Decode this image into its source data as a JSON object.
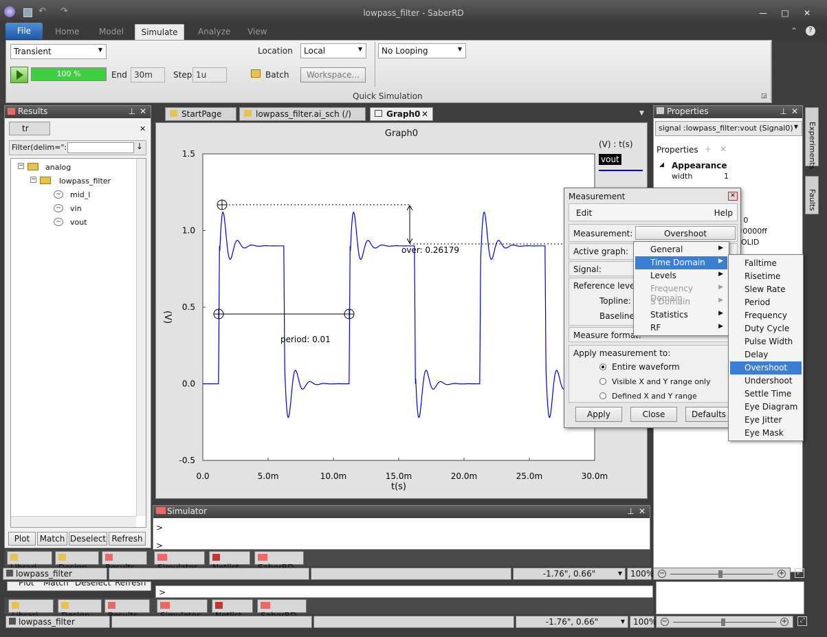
{
  "window": {
    "title": "lowpass_filter - SaberRD"
  },
  "ribbon": {
    "tabs": [
      "File",
      "Home",
      "Model",
      "Simulate",
      "Analyze",
      "View"
    ],
    "analysis_type": "Transient",
    "progress_text": "100 %",
    "progress": 1.0,
    "end_label": "End",
    "end_value": "30m",
    "step_label": "Step",
    "step_value": "1u",
    "location_label": "Location",
    "location_value": "Local",
    "batch_label": "Batch",
    "workspace_label": "Workspace...",
    "looping_value": "No Looping",
    "group_label": "Quick Simulation"
  },
  "results": {
    "title": "Results",
    "tab": "tr",
    "filter_label": "Filter(delim=\":\")",
    "tree": {
      "root": "analog",
      "child": "lowpass_filter",
      "signals": [
        "mid_l",
        "vin",
        "vout"
      ]
    },
    "buttons": [
      "Plot",
      "Match",
      "Deselect",
      "Refresh"
    ]
  },
  "doc_tabs": [
    "StartPage",
    "lowpass_filter.ai_sch (/)",
    "Graph0"
  ],
  "graph": {
    "title": "Graph0",
    "legend_units": "(V) : t(s)",
    "legend_signal": "vout",
    "ylabel": "(V)",
    "xlabel": "t(s)",
    "over_annotation": "over: 0.26179",
    "period_annotation": "period: 0.01",
    "y_ticks": [
      "1.5",
      "1.0",
      "0.5",
      "0.0",
      "-0.5"
    ],
    "x_ticks": [
      "0.0",
      "5.0m",
      "10.0m",
      "15.0m",
      "20.0m",
      "25.0m",
      "30.0m"
    ],
    "color_signal": "#0000cc"
  },
  "chart_data": {
    "type": "line",
    "title": "Graph0",
    "xlabel": "t(s)",
    "ylabel": "(V)",
    "xlim": [
      0,
      0.03
    ],
    "ylim": [
      -0.5,
      1.5
    ],
    "series": [
      {
        "name": "vout",
        "color": "#0000cc"
      }
    ],
    "square_wave": {
      "period": 0.01,
      "high": 0.9,
      "low": 0.0,
      "overshoot": 0.26179,
      "first_rise": 0.0012
    },
    "annotations": [
      "over: 0.26179",
      "period: 0.01"
    ]
  },
  "simulator": {
    "title": "Simulator",
    "prompt1": ">",
    "prompt2": ">"
  },
  "properties": {
    "title": "Properties",
    "signal_selector": "signal :lowpass_filter:vout (Signal0)",
    "sub_title": "Properties",
    "section": "Appearance",
    "width_label": "width",
    "width_value": "1",
    "partial1": "g 0",
    "partial2": "#0000ff",
    "partial3": "SOLID"
  },
  "side_tabs": [
    "Experiments",
    "Faults"
  ],
  "measurement": {
    "title": "Measurement",
    "menu_edit": "Edit",
    "menu_help": "Help",
    "measurement_label": "Measurement:",
    "measurement_value": "Overshoot",
    "active_graph_label": "Active graph:",
    "signal_label": "Signal:",
    "reference_label": "Reference levels:",
    "topline_label": "Topline:",
    "baseline_label": "Baseline:",
    "format_label": "Measure format:",
    "apply_to_label": "Apply measurement to:",
    "opt_entire": "Entire waveform",
    "opt_visible": "Visible X and Y range only",
    "opt_defined": "Defined X and Y range",
    "apply": "Apply",
    "close": "Close",
    "defaults": "Defaults"
  },
  "menu1": [
    "General",
    "Time Domain",
    "Levels",
    "Frequency Domain",
    "S Domain",
    "Statistics",
    "RF"
  ],
  "menu2": [
    "Falltime",
    "Risetime",
    "Slew Rate",
    "Period",
    "Frequency",
    "Duty Cycle",
    "Pulse Width",
    "Delay",
    "Overshoot",
    "Undershoot",
    "Settle Time",
    "Eye Diagram",
    "Eye Jitter",
    "Eye Mask"
  ],
  "bottom_tabs_left": [
    "Librari...",
    "Design",
    "Results"
  ],
  "bottom_tabs_mid": [
    "Simulator",
    "Netlist",
    "SaberRD"
  ],
  "status": {
    "doc": "lowpass_filter",
    "coords": "-1.76\",  0.66\"",
    "zoom": "100%"
  }
}
